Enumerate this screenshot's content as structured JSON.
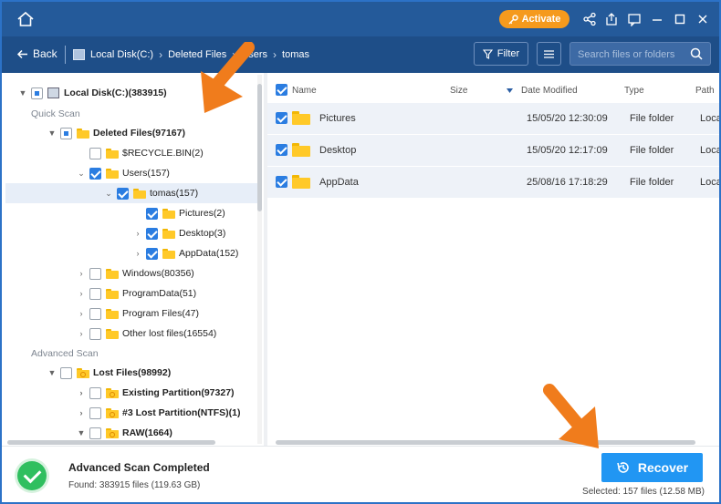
{
  "titlebar": {
    "activate_label": "Activate"
  },
  "nav": {
    "back_label": "Back",
    "breadcrumb": [
      "Local Disk(C:)",
      "Deleted Files",
      "Users",
      "tomas"
    ],
    "filter_label": "Filter",
    "search_placeholder": "Search files or folders"
  },
  "tree": {
    "root": "Local Disk(C:)(383915)",
    "quick_scan_label": "Quick Scan",
    "advanced_scan_label": "Advanced Scan",
    "items": [
      {
        "label": "Deleted Files(97167)"
      },
      {
        "label": "$RECYCLE.BIN(2)"
      },
      {
        "label": "Users(157)"
      },
      {
        "label": "tomas(157)"
      },
      {
        "label": "Pictures(2)"
      },
      {
        "label": "Desktop(3)"
      },
      {
        "label": "AppData(152)"
      },
      {
        "label": "Windows(80356)"
      },
      {
        "label": "ProgramData(51)"
      },
      {
        "label": "Program Files(47)"
      },
      {
        "label": "Other lost files(16554)"
      },
      {
        "label": "Lost Files(98992)"
      },
      {
        "label": "Existing Partition(97327)"
      },
      {
        "label": "#3 Lost Partition(NTFS)(1)"
      },
      {
        "label": "RAW(1664)"
      }
    ]
  },
  "list": {
    "columns": [
      "Name",
      "Size",
      "Date Modified",
      "Type",
      "Path"
    ],
    "rows": [
      {
        "name": "Pictures",
        "size": "",
        "date": "15/05/20 12:30:09",
        "type": "File folder",
        "path": "Loca"
      },
      {
        "name": "Desktop",
        "size": "",
        "date": "15/05/20 12:17:09",
        "type": "File folder",
        "path": "Loca"
      },
      {
        "name": "AppData",
        "size": "",
        "date": "25/08/16 17:18:29",
        "type": "File folder",
        "path": "Loca"
      }
    ]
  },
  "bottom": {
    "status_title": "Advanced Scan Completed",
    "found_text": "Found: 383915 files (119.63 GB)",
    "recover_label": "Recover",
    "selected_text": "Selected: 157 files (12.58 MB)"
  },
  "colors": {
    "titlebar": "#245a9a",
    "navbar": "#1e4e88",
    "accent": "#2196f3",
    "activate": "#f59a1d",
    "annotation_arrow": "#f07c1c"
  }
}
